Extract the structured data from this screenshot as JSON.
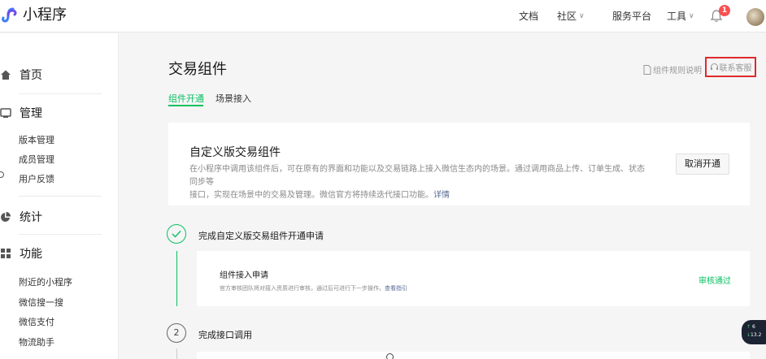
{
  "app": {
    "logo_text": "小程序"
  },
  "topnav": {
    "docs": "文档",
    "community": "社区",
    "service": "服务平台",
    "tools": "工具",
    "notification_count": "1"
  },
  "sidebar": {
    "home": "首页",
    "manage": "管理",
    "manage_items": [
      "版本管理",
      "成员管理",
      "用户反馈"
    ],
    "stats": "统计",
    "features": "功能",
    "feature_items": [
      "附近的小程序",
      "微信搜一搜",
      "微信支付",
      "物流助手"
    ]
  },
  "page": {
    "title": "交易组件",
    "doc_link": "组件规则说明",
    "contact": "联系客服",
    "tabs": [
      "组件开通",
      "场景接入"
    ]
  },
  "intro": {
    "title": "自定义版交易组件",
    "desc_line1": "在小程序中调用该组件后，可在原有的界面和功能以及交易链路上接入微信生态内的场景。通过调用商品上传、订单生成、状态同步等",
    "desc_line2": "接口，实现在场景中的交易及管理。微信官方将持续迭代接口功能。",
    "desc_link": "详情",
    "cancel_button": "取消开通"
  },
  "steps": [
    {
      "label": "完成自定义版交易组件开通申请",
      "sub": {
        "title": "组件接入申请",
        "desc": "官方审核团队将对接入资质进行审核，通过后可进行下一步操作。",
        "desc_link": "查看指引",
        "status": "审核通过"
      }
    },
    {
      "number": "2",
      "label": "完成接口调用"
    }
  ],
  "float_widget": {
    "line1": "6",
    "line2": "13.2"
  },
  "colors": {
    "brand_green": "#07c160",
    "link_blue": "#576b95",
    "highlight_red": "#e02a2a",
    "badge_red": "#fa5151"
  }
}
